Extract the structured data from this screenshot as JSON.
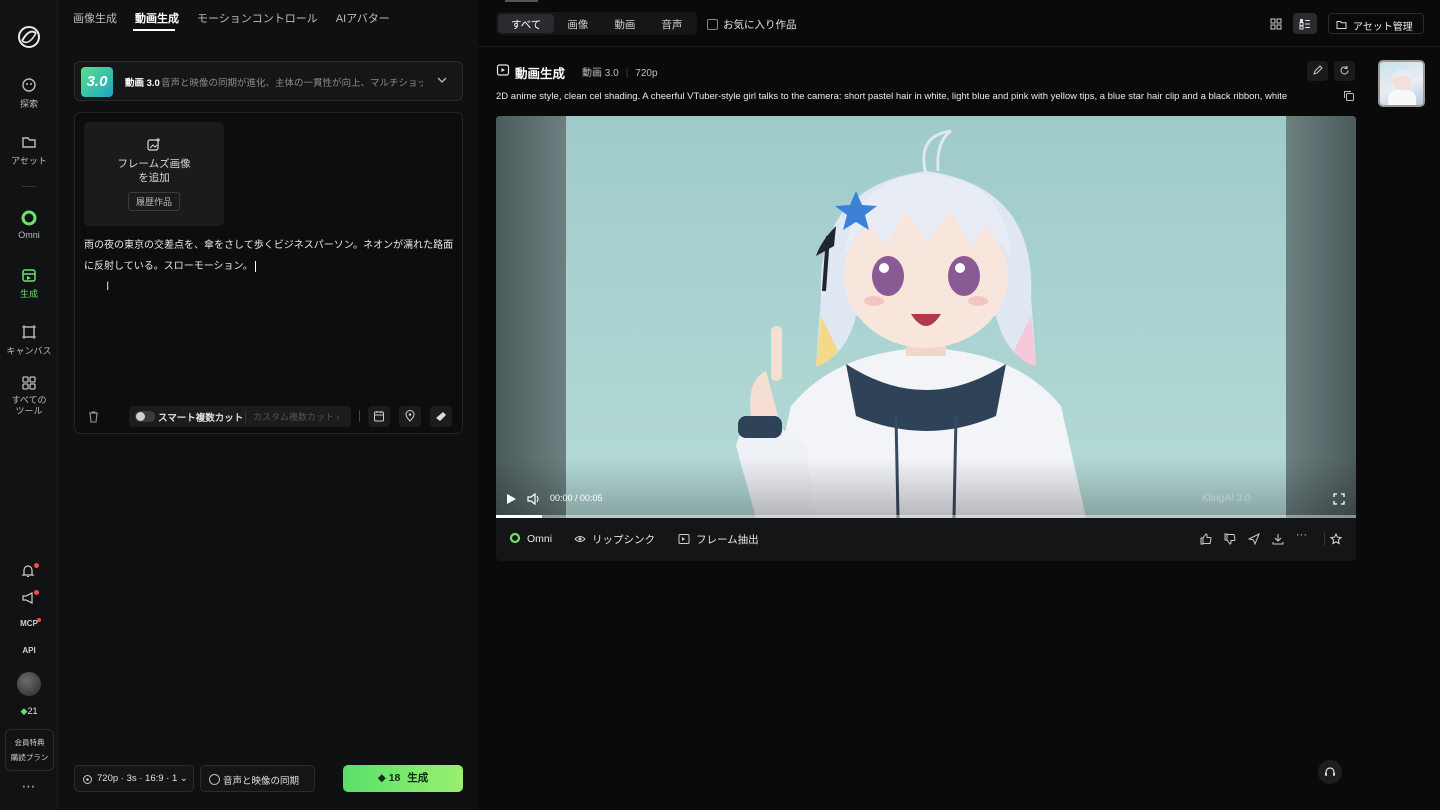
{
  "sidebar": {
    "items": [
      {
        "label": "探索"
      },
      {
        "label": "アセット"
      },
      {
        "label": "Omni"
      },
      {
        "label": "生成"
      },
      {
        "label": "キャンバス"
      },
      {
        "label": "すべてのツール"
      }
    ],
    "mcp_label": "MCP",
    "api_label": "API",
    "credits": "21",
    "member_line1": "会員特典",
    "member_line2": "購読プラン",
    "more": "⋯"
  },
  "left": {
    "tabs": [
      {
        "label": "画像生成"
      },
      {
        "label": "動画生成"
      },
      {
        "label": "モーションコントロール"
      },
      {
        "label": "AIアバター"
      }
    ],
    "model": {
      "badge": "3.0",
      "name": "動画 3.0",
      "description": "音声と映像の同期が進化、主体の一貫性が向上、マルチショッ..."
    },
    "frames": {
      "add_label_line1": "フレームズ画像",
      "add_label_line2": "を追加",
      "history_button": "履歴作品"
    },
    "prompt_text": "雨の夜の東京の交差点を、傘をさして歩くビジネスパーソン。ネオンが濡れた路面に反射している。スローモーション。",
    "toolbar": {
      "smart_cut": "スマート複数カット",
      "custom_cut": "カスタム複数カット ›"
    },
    "bottom": {
      "settings": "720p · 3s · 16:9 · 1",
      "sync": "音声と映像の同期",
      "generate_cost": "18",
      "generate_label": "生成"
    }
  },
  "right": {
    "filters": [
      {
        "label": "すべて"
      },
      {
        "label": "画像"
      },
      {
        "label": "動画"
      },
      {
        "label": "音声"
      }
    ],
    "favorites_label": "お気に入り作品",
    "asset_button": "アセット管理",
    "card": {
      "title": "動画生成",
      "model": "動画 3.0",
      "resolution": "720p",
      "prompt": "2D anime style, clean cel shading. A cheerful VTuber-style girl talks to the camera: short pastel hair in white, light blue and pink with yellow tips, a blue star hair clip and a black ribbon, white",
      "time": "00:00 / 00:05",
      "watermark": "KlingAI 3.0",
      "progress": 0.053,
      "actions": [
        {
          "label": "Omni"
        },
        {
          "label": "リップシンク"
        },
        {
          "label": "フレーム抽出"
        }
      ]
    }
  },
  "colors": {
    "accent_green": "#6ee06e",
    "generate_gradient_start": "#58e06a",
    "generate_gradient_end": "#9af06e",
    "notification_red": "#ff4a4a"
  }
}
